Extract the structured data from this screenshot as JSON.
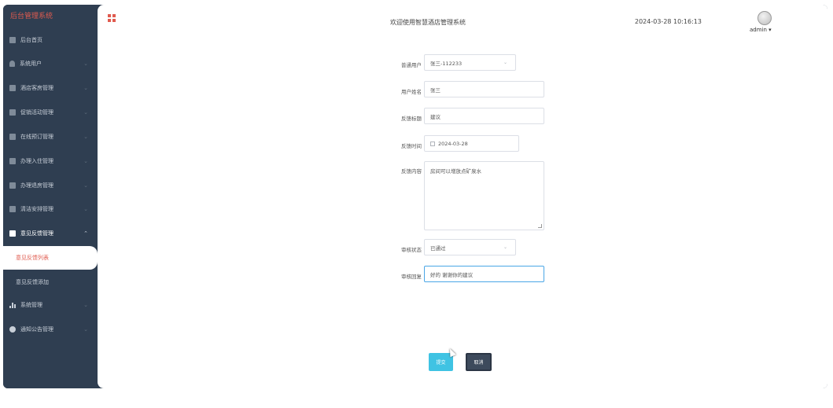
{
  "sidebar": {
    "brand": "后台管理系统",
    "items": [
      {
        "label": "后台首页",
        "icon": "home-icon"
      },
      {
        "label": "系统用户",
        "icon": "user-icon"
      },
      {
        "label": "酒店客房管理",
        "icon": "grid-icon"
      },
      {
        "label": "促销活动管理",
        "icon": "grid-icon"
      },
      {
        "label": "在线预订管理",
        "icon": "grid-icon"
      },
      {
        "label": "办理入住管理",
        "icon": "grid-icon"
      },
      {
        "label": "办理退房管理",
        "icon": "grid-icon"
      },
      {
        "label": "清洁安排管理",
        "icon": "grid-icon"
      },
      {
        "label": "意见反馈管理",
        "icon": "grid-icon"
      },
      {
        "label": "系统管理",
        "icon": "bar-chart-icon"
      },
      {
        "label": "通知公告管理",
        "icon": "info-icon"
      }
    ],
    "subitems": [
      {
        "label": "意见反馈列表"
      },
      {
        "label": "意见反馈添加"
      }
    ]
  },
  "header": {
    "welcome": "欢迎使用智慧酒店管理系统",
    "datetime": "2024-03-28 10:16:13",
    "username": "admin ▾"
  },
  "form": {
    "user_label": "普通用户",
    "user_value": "张三-112233",
    "name_label": "用户姓名",
    "name_value": "张三",
    "title_label": "反馈标题",
    "title_value": "建议",
    "time_label": "反馈时间",
    "time_value": "2024-03-28",
    "content_label": "反馈内容",
    "content_value": "房间可以增放点矿泉水",
    "status_label": "审核状态",
    "status_value": "已通过",
    "reply_label": "审核回复",
    "reply_value": "好的 谢谢你的建议"
  },
  "buttons": {
    "submit": "提交",
    "cancel": "取消"
  },
  "colors": {
    "sidebar_bg": "#2f3e51",
    "accent_red": "#e05b4f",
    "submit_bg": "#3fc3e3"
  }
}
